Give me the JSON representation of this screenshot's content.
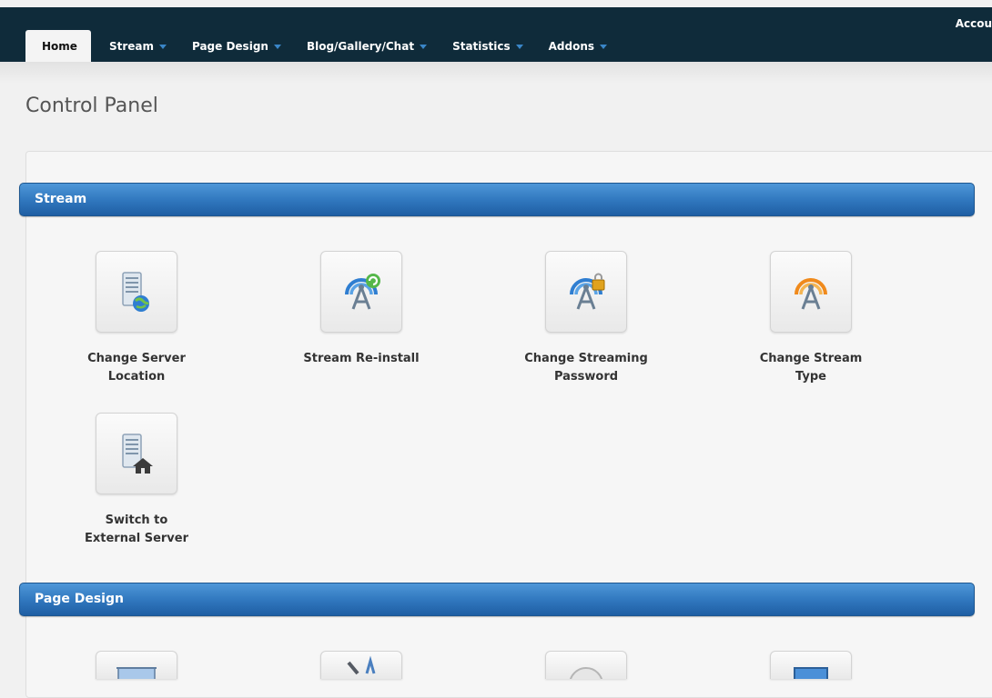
{
  "nav": {
    "account_label": "Accou",
    "tabs": [
      {
        "label": "Home"
      },
      {
        "label": "Stream"
      },
      {
        "label": "Page Design"
      },
      {
        "label": "Blog/Gallery/Chat"
      },
      {
        "label": "Statistics"
      },
      {
        "label": "Addons"
      }
    ],
    "accent_color": "#3a86c8",
    "bar_color": "#0f2b3a"
  },
  "page": {
    "title": "Control Panel"
  },
  "sections": [
    {
      "title": "Stream",
      "header_color": "#2f76bd",
      "tiles": [
        {
          "label": "Change Server Location",
          "icon": "server-globe-icon"
        },
        {
          "label": "Stream Re-install",
          "icon": "broadcast-refresh-icon"
        },
        {
          "label": "Change Streaming Password",
          "icon": "broadcast-lock-icon"
        },
        {
          "label": "Change Stream Type",
          "icon": "broadcast-orange-icon"
        },
        {
          "label": "Switch to External Server",
          "icon": "server-home-icon"
        }
      ]
    },
    {
      "title": "Page Design",
      "header_color": "#2f76bd",
      "tiles": [
        {
          "label": "",
          "icon": "background-image-icon"
        },
        {
          "label": "",
          "icon": "design-tools-icon"
        },
        {
          "label": "",
          "icon": "circle-icon"
        },
        {
          "label": "",
          "icon": "monitor-icon"
        }
      ]
    }
  ]
}
